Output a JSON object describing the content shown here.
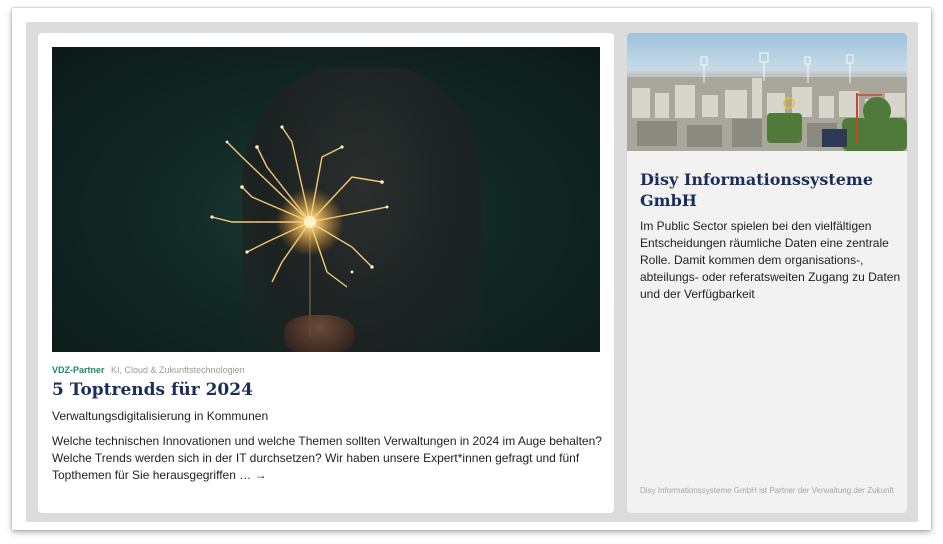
{
  "main_card": {
    "partner_label": "VDZ-Partner",
    "category": "KI, Cloud & Zukunftstechnologien",
    "title": "5 Toptrends für 2024",
    "subtitle": "Verwaltungsdigitalisierung in Kommunen",
    "description": "Welche technischen Innovationen und welche Themen sollten Verwaltungen in 2024 im Auge behalten? Welche Trends werden sich in der IT durchsetzen? Wir haben unsere Expert*innen gefragt und fünf Topthemen für Sie herausgegriffen …",
    "read_more": "→",
    "image_icon": "sparkler-photo"
  },
  "side_card": {
    "title": "Disy Informationssysteme GmbH",
    "description": "Im Public Sector spielen bei den vielfältigen Entscheidungen räumliche Daten eine zentrale Rolle. Damit kommen dem organisations-, abteilungs- oder referatsweiten Zugang zu Daten und der Verfügbarkeit",
    "footnote": "Disy Informationssysteme GmbH ist Partner der Verwaltung der Zukunft",
    "image_icon": "city-aerial-photo"
  },
  "colors": {
    "title": "#1b2d5a",
    "partner": "#1a8a6d",
    "panel_bg": "#dcdcdc",
    "side_card_bg": "#f2f2f2"
  }
}
